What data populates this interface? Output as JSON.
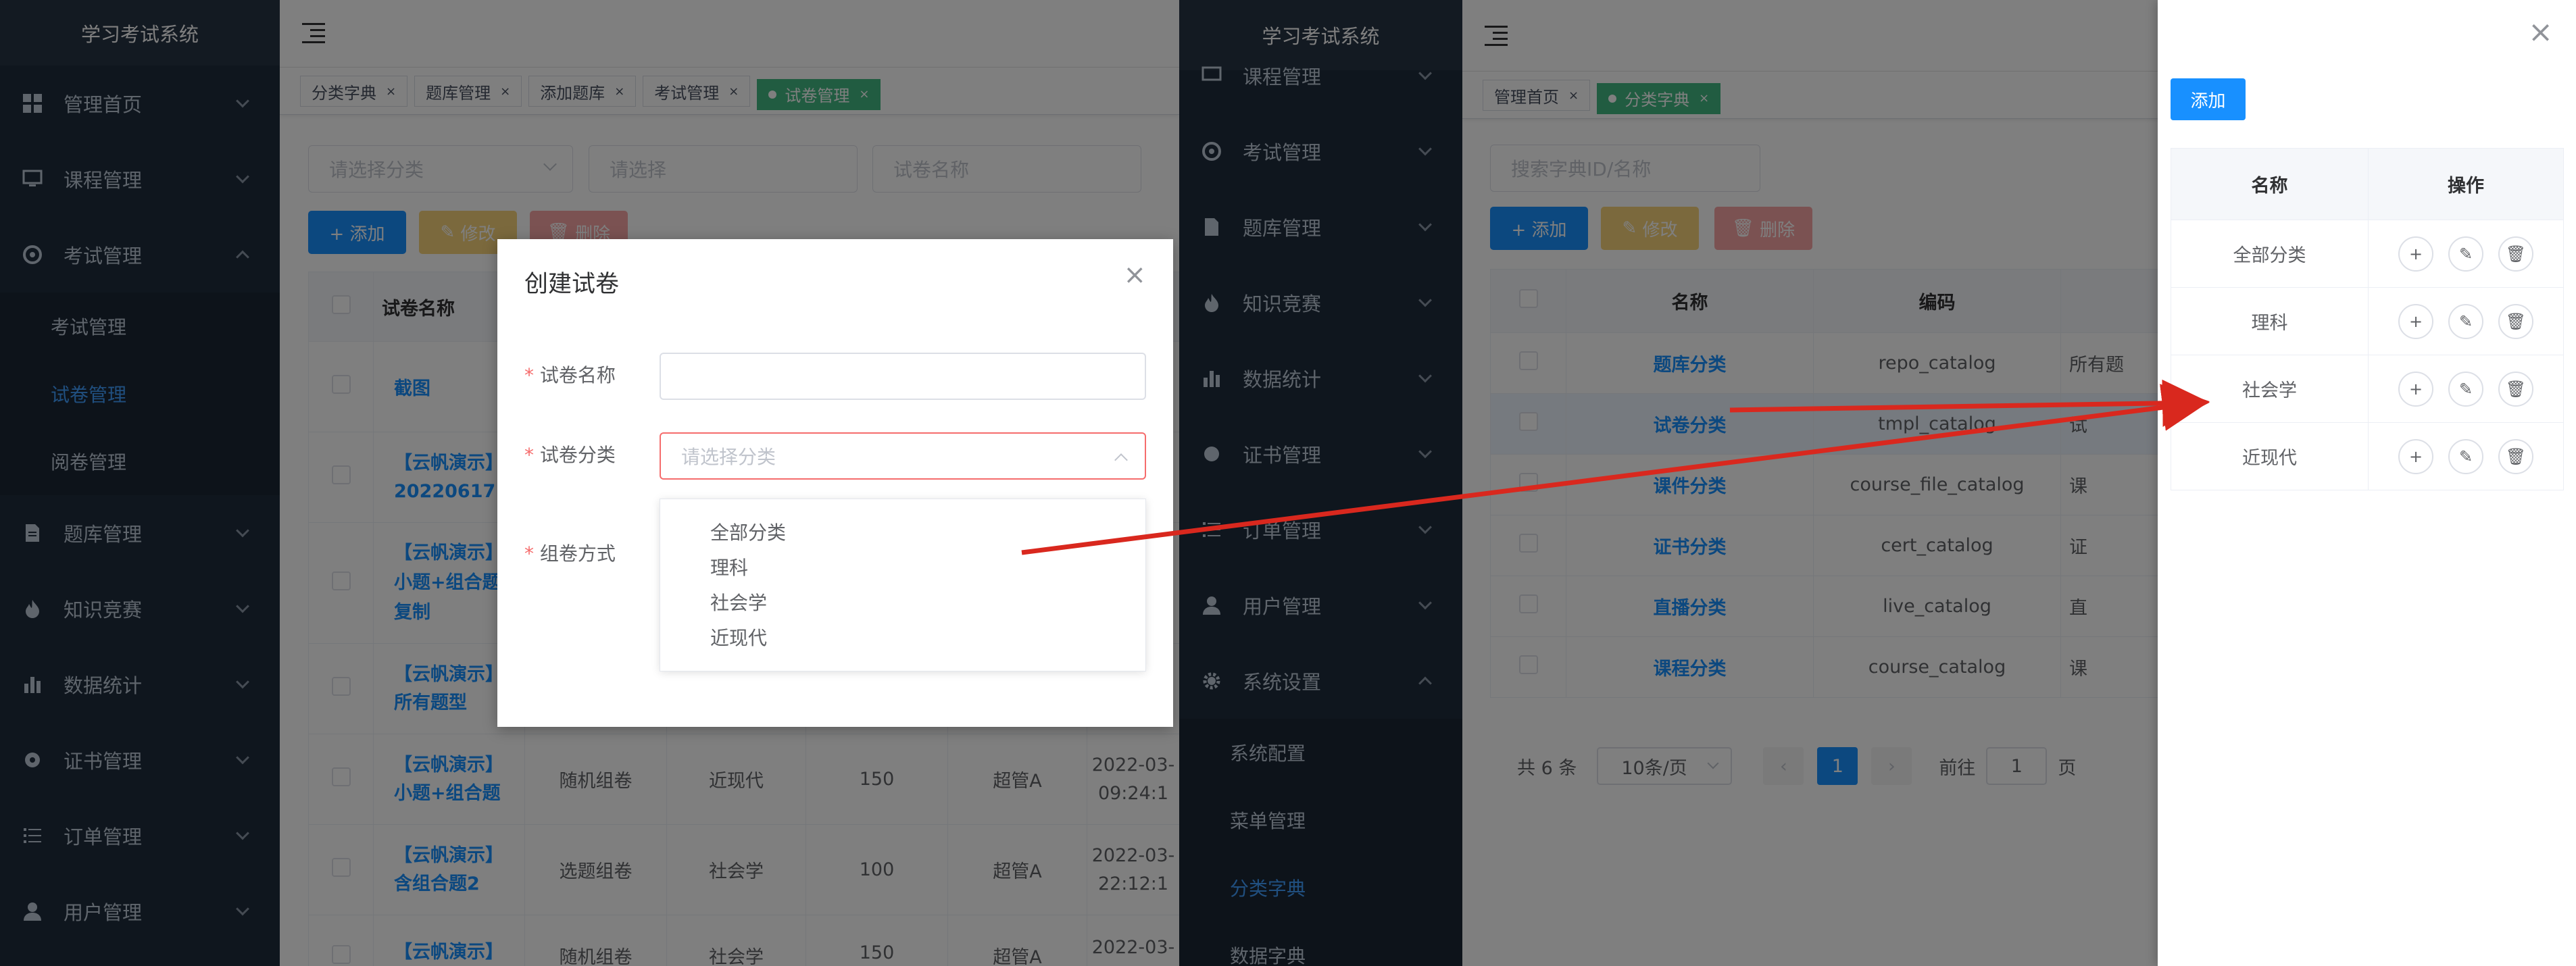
{
  "left_app": {
    "brand": "学习考试系统",
    "menu": [
      {
        "label": "管理首页",
        "icon": "dashboard-icon",
        "expanded": false
      },
      {
        "label": "课程管理",
        "icon": "monitor-icon",
        "expanded": false
      },
      {
        "label": "考试管理",
        "icon": "exam-icon",
        "expanded": true,
        "children": [
          {
            "label": "考试管理",
            "active": false
          },
          {
            "label": "试卷管理",
            "active": true
          },
          {
            "label": "阅卷管理",
            "active": false
          }
        ]
      },
      {
        "label": "题库管理",
        "icon": "document-icon",
        "expanded": false
      },
      {
        "label": "知识竞赛",
        "icon": "fire-icon",
        "expanded": false
      },
      {
        "label": "数据统计",
        "icon": "bar-chart-icon",
        "expanded": false
      },
      {
        "label": "证书管理",
        "icon": "certificate-icon",
        "expanded": false
      },
      {
        "label": "订单管理",
        "icon": "list-icon",
        "expanded": false
      },
      {
        "label": "用户管理",
        "icon": "user-icon",
        "expanded": false
      }
    ],
    "tags": [
      {
        "label": "分类字典",
        "active": false
      },
      {
        "label": "题库管理",
        "active": false
      },
      {
        "label": "添加题库",
        "active": false
      },
      {
        "label": "考试管理",
        "active": false
      },
      {
        "label": "试卷管理",
        "active": true
      }
    ],
    "filters": {
      "category_placeholder": "请选择分类",
      "select_placeholder": "请选择",
      "name_placeholder": "试卷名称"
    },
    "buttons": {
      "add": "+ 添加",
      "edit": "修改",
      "delete": "删除"
    },
    "table": {
      "headers": [
        "试卷名称"
      ],
      "rows": [
        {
          "name": "截图",
          "name2": "",
          "name3": "",
          "type": "",
          "cat": "",
          "score": "",
          "user": "",
          "time": "",
          "time2": ""
        },
        {
          "name": "【云帆演示】",
          "name2": "20220617",
          "name3": "",
          "type": "",
          "cat": "",
          "score": "",
          "user": "",
          "time": "",
          "time2": ""
        },
        {
          "name": "【云帆演示】",
          "name2": "小题+组合题",
          "name3": "复制",
          "type": "",
          "cat": "",
          "score": "",
          "user": "",
          "time": "",
          "time2": ""
        },
        {
          "name": "【云帆演示】",
          "name2": "所有题型",
          "name3": "",
          "type": "",
          "cat": "",
          "score": "",
          "user": "",
          "time": "",
          "time2": ""
        },
        {
          "name": "【云帆演示】",
          "name2": "小题+组合题",
          "name3": "",
          "type": "随机组卷",
          "cat": "近现代",
          "score": "150",
          "user": "超管A",
          "time": "2022-03-",
          "time2": "09:24:1"
        },
        {
          "name": "【云帆演示】",
          "name2": "含组合题2",
          "name3": "",
          "type": "选题组卷",
          "cat": "社会学",
          "score": "100",
          "user": "超管A",
          "time": "2022-03-",
          "time2": "22:12:1"
        },
        {
          "name": "【云帆演示】",
          "name2": "",
          "name3": "",
          "type": "随机组卷",
          "cat": "社会学",
          "score": "150",
          "user": "超管A",
          "time": "2022-03-",
          "time2": ""
        }
      ]
    },
    "dialog": {
      "title": "创建试卷",
      "name_label": "试卷名称",
      "category_label": "试卷分类",
      "category_placeholder": "请选择分类",
      "method_label": "组卷方式",
      "options": [
        "全部分类",
        "理科",
        "社会学",
        "近现代"
      ]
    }
  },
  "right_app": {
    "brand": "学习考试系统",
    "menu": [
      {
        "label": "课程管理",
        "icon": "monitor-icon"
      },
      {
        "label": "考试管理",
        "icon": "exam-icon"
      },
      {
        "label": "题库管理",
        "icon": "document-icon"
      },
      {
        "label": "知识竞赛",
        "icon": "fire-icon"
      },
      {
        "label": "数据统计",
        "icon": "bar-chart-icon"
      },
      {
        "label": "证书管理",
        "icon": "certificate-icon"
      },
      {
        "label": "订单管理",
        "icon": "list-icon"
      },
      {
        "label": "用户管理",
        "icon": "user-icon"
      },
      {
        "label": "系统设置",
        "icon": "gear-icon",
        "expanded": true,
        "children": [
          {
            "label": "系统配置",
            "active": false
          },
          {
            "label": "菜单管理",
            "active": false
          },
          {
            "label": "分类字典",
            "active": true
          },
          {
            "label": "数据字典",
            "active": false
          }
        ]
      }
    ],
    "tags": [
      {
        "label": "管理首页",
        "active": false
      },
      {
        "label": "分类字典",
        "active": true
      }
    ],
    "search_placeholder": "搜索字典ID/名称",
    "buttons": {
      "add": "+ 添加",
      "edit": "修改",
      "delete": "删除"
    },
    "table": {
      "headers": [
        "名称",
        "编码"
      ],
      "rows": [
        {
          "name": "题库分类",
          "code": "repo_catalog",
          "remark": "所有题"
        },
        {
          "name": "试卷分类",
          "code": "tmpl_catalog",
          "remark": "试"
        },
        {
          "name": "课件分类",
          "code": "course_file_catalog",
          "remark": "课"
        },
        {
          "name": "证书分类",
          "code": "cert_catalog",
          "remark": "证"
        },
        {
          "name": "直播分类",
          "code": "live_catalog",
          "remark": "直"
        },
        {
          "name": "课程分类",
          "code": "course_catalog",
          "remark": "课"
        }
      ]
    },
    "pagination": {
      "total": "共 6 条",
      "page_size": "10条/页",
      "current": "1",
      "goto_label": "前往",
      "goto_value": "1",
      "page_unit": "页"
    },
    "drawer": {
      "add": "添加",
      "headers": [
        "名称",
        "操作"
      ],
      "rows": [
        "全部分类",
        "理科",
        "社会学",
        "近现代"
      ]
    }
  },
  "colors": {
    "primary": "#1890ff",
    "sidebar": "#1f2d3d",
    "active_tag": "#42b983",
    "arrow": "#d9281e"
  }
}
